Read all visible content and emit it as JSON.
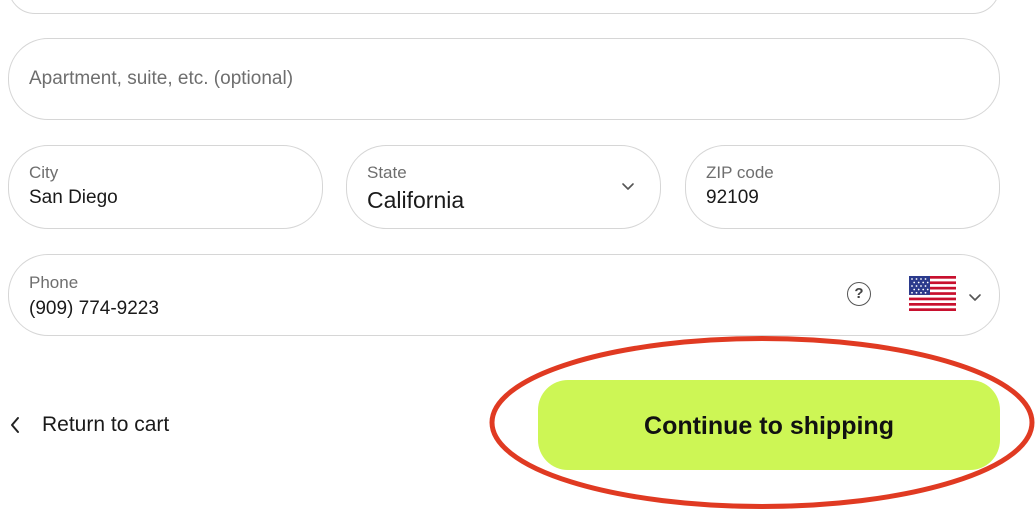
{
  "address_line2": {
    "placeholder": "Apartment, suite, etc. (optional)"
  },
  "city": {
    "label": "City",
    "value": "San Diego"
  },
  "state": {
    "label": "State",
    "value": "California"
  },
  "zip": {
    "label": "ZIP code",
    "value": "92109"
  },
  "phone": {
    "label": "Phone",
    "value": "(909) 774-9223",
    "help_glyph": "?",
    "country_flag": "us-flag-icon"
  },
  "footer": {
    "back_label": "Return to cart",
    "continue_label": "Continue to shipping"
  },
  "colors": {
    "accent": "#cdf655",
    "highlight": "#e03a22",
    "border": "#d6d6d6"
  }
}
